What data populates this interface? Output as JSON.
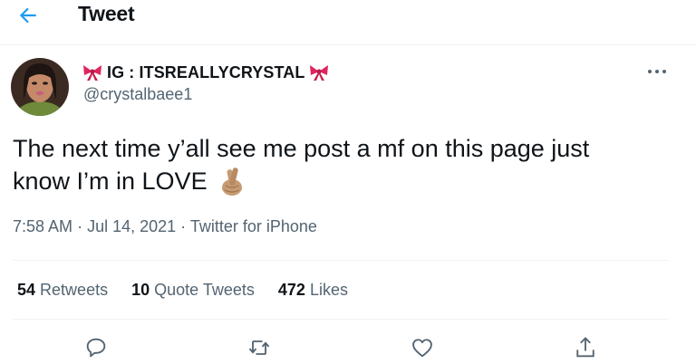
{
  "header": {
    "title": "Tweet"
  },
  "author": {
    "display_name": "IG : ITSREALLYCRYSTAL",
    "handle": "@crystalbaee1"
  },
  "tweet": {
    "text_line1": "The next time y’all see me post a mf on this page just",
    "text_line2": "know I’m in LOVE",
    "emoji": "crossed-fingers-emoji",
    "time": "7:58 AM",
    "date": "Jul 14, 2021",
    "source": "Twitter for iPhone",
    "separator": "·"
  },
  "stats": {
    "retweets_count": "54",
    "retweets_label": "Retweets",
    "quotes_count": "10",
    "quotes_label": "Quote Tweets",
    "likes_count": "472",
    "likes_label": "Likes"
  },
  "icons": {
    "back": "arrow-left-icon",
    "more": "more-icon",
    "reply": "reply-icon",
    "retweet": "retweet-icon",
    "like": "heart-icon",
    "share": "share-icon"
  },
  "colors": {
    "accent": "#1d9bf0",
    "text": "#0f1419",
    "secondary": "#536471",
    "divider": "#eff3f4",
    "bow": "#e0245e"
  }
}
